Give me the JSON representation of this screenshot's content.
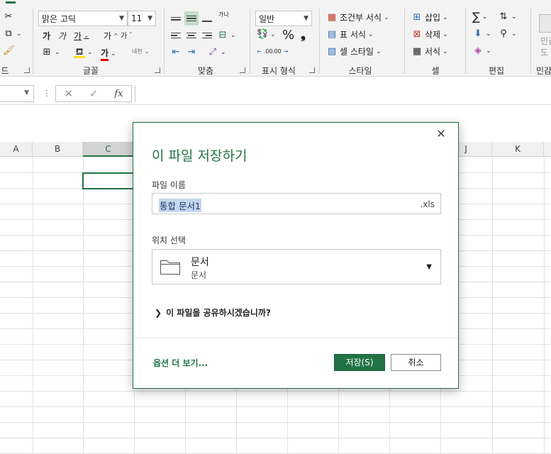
{
  "ribbon": {
    "groups": {
      "clipboard_tail": "드",
      "font": "글꼴",
      "alignment": "맞춤",
      "number": "표시 형식",
      "styles": "스타일",
      "cells": "셀",
      "editing": "편집",
      "sensitivity": "민감"
    },
    "font_name": "맑은 고딕",
    "font_size": "11",
    "number_format": "일반",
    "styles_items": [
      "조건부 서식",
      "표 서식",
      "셀 스타일"
    ],
    "cells_items": [
      "삽입",
      "삭제",
      "서식"
    ],
    "sensitivity_btn": "민감\n도",
    "bold_glyph": "가",
    "italic_glyph": "가",
    "underline_glyph": "가",
    "grow_glyph": "가",
    "shrink_glyph": "가",
    "font_color_glyph": "가",
    "phonetic_glyph": "내천",
    "wrap_glyph": "가나",
    "percent": "%",
    "comma": "❟",
    "sum": "∑",
    "inc_decimal": ".00",
    "dec_decimal": ".00"
  },
  "formula_bar": {
    "fx_label": "fx",
    "cancel_glyph": "✕",
    "enter_glyph": "✓",
    "dots": "⋮"
  },
  "grid": {
    "columns": [
      "A",
      "B",
      "C",
      "J",
      "K"
    ],
    "selected_column": "C"
  },
  "dialog": {
    "title": "이 파일 저장하기",
    "filename_label": "파일 이름",
    "filename_value": "통합 문서1",
    "extension": ".xls",
    "location_label": "위치 선택",
    "location_name": "문서",
    "location_sub": "문서",
    "share_text": "이 파일을 공유하시겠습니까?",
    "more_options": "옵션 더 보기...",
    "save_button": "저장(S)",
    "cancel_button": "취소",
    "accent": "#217346"
  }
}
